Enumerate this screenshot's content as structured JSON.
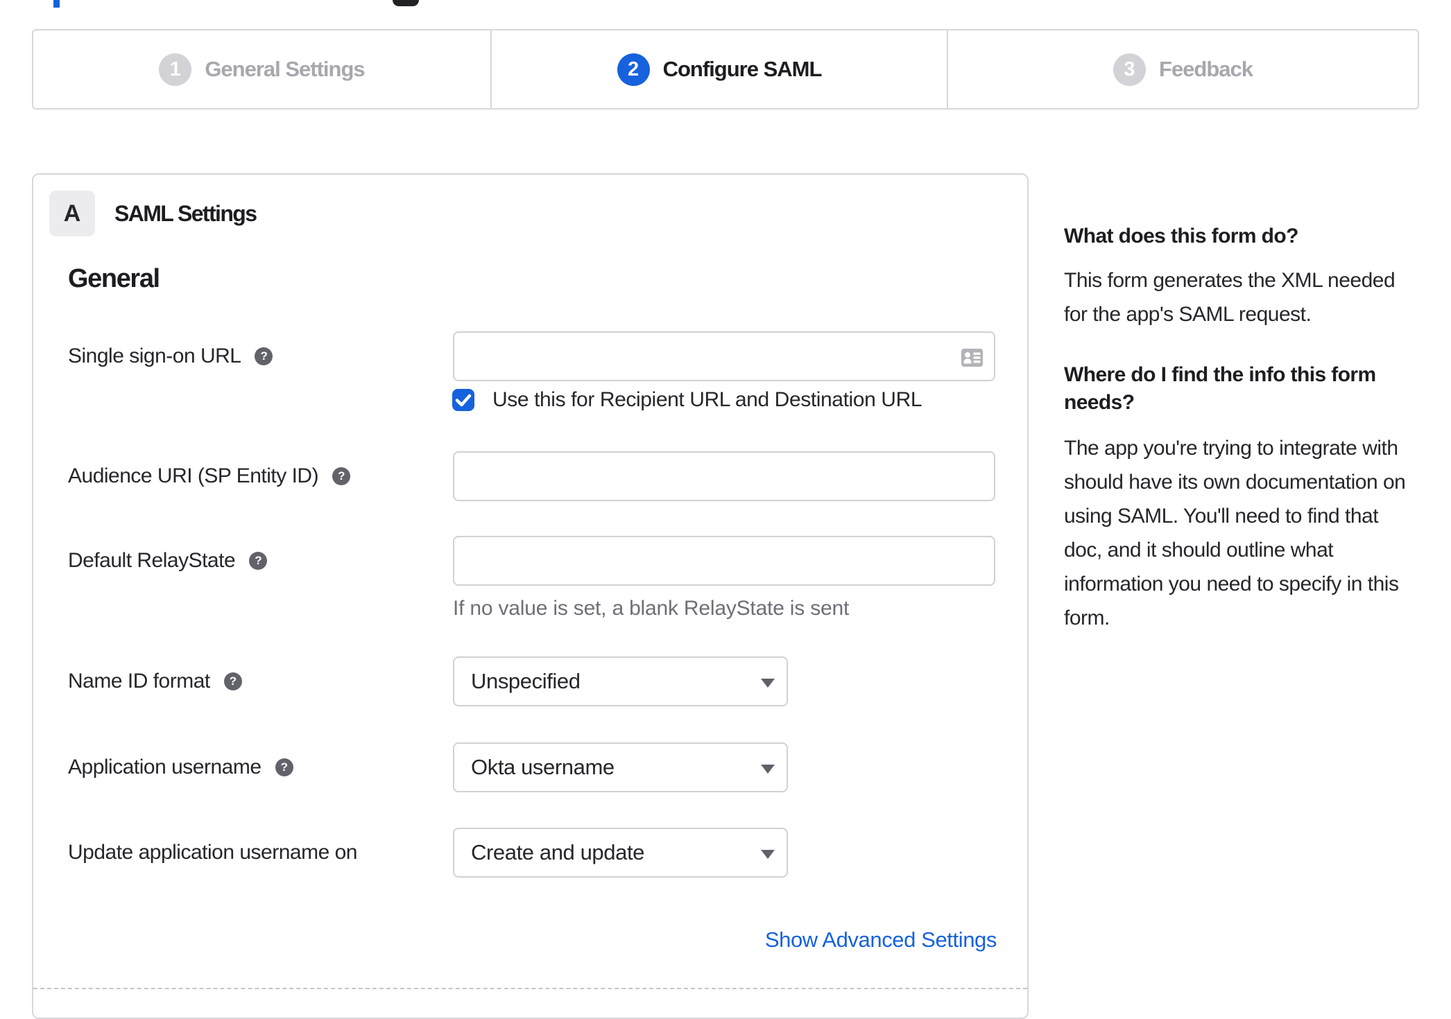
{
  "colors": {
    "accent_blue": "#1662dd",
    "border_gray": "#d7d7dc",
    "text_dark": "#1d1d21",
    "text_muted": "#6e6e78",
    "step_inactive_gray": "#a7a7ae"
  },
  "stepper": {
    "steps": [
      {
        "number": "1",
        "label": "General Settings",
        "state": "inactive"
      },
      {
        "number": "2",
        "label": "Configure SAML",
        "state": "active"
      },
      {
        "number": "3",
        "label": "Feedback",
        "state": "inactive"
      }
    ]
  },
  "panel": {
    "badge": "A",
    "title": "SAML Settings",
    "section_heading": "General",
    "rows": {
      "sso_url": {
        "label": "Single sign-on URL",
        "value": "",
        "checkbox_label": "Use this for Recipient URL and Destination URL",
        "checkbox_checked": true
      },
      "audience_uri": {
        "label": "Audience URI (SP Entity ID)",
        "value": ""
      },
      "relay_state": {
        "label": "Default RelayState",
        "value": "",
        "hint": "If no value is set, a blank RelayState is sent"
      },
      "name_id_format": {
        "label": "Name ID format",
        "value": "Unspecified"
      },
      "app_username": {
        "label": "Application username",
        "value": "Okta username"
      },
      "update_app_username": {
        "label": "Update application username on",
        "value": "Create and update"
      }
    },
    "advanced_link": "Show Advanced Settings"
  },
  "sidebar": {
    "heading1": "What does this form do?",
    "para1_lines": [
      "This form generates the XML needed",
      "for the app's SAML request."
    ],
    "heading2_lines": [
      "Where do I find the info this form",
      "needs?"
    ],
    "para2_lines": [
      "The app you're trying to integrate with",
      "should have its own documentation on",
      "using SAML. You'll need to find that",
      "doc, and it should outline what",
      "information you need to specify in this",
      "form."
    ]
  }
}
